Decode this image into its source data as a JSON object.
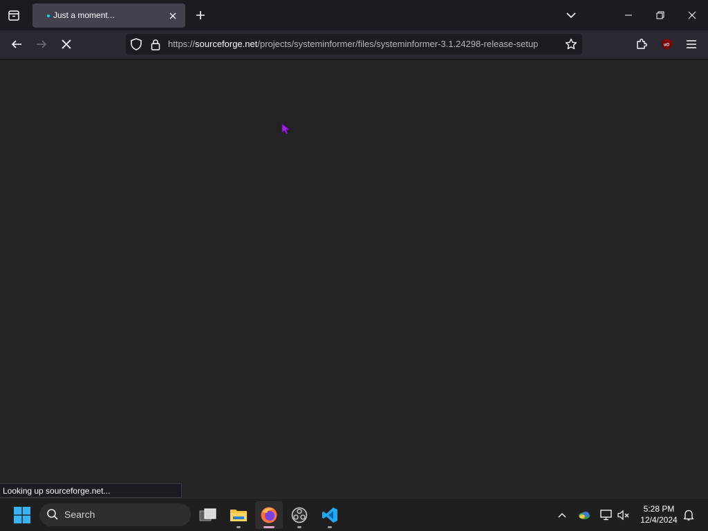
{
  "browser": {
    "tab": {
      "title": "Just a moment..."
    },
    "url": {
      "scheme": "https://",
      "host": "sourceforge.net",
      "path": "/projects/systeminformer/files/systeminformer-3.1.24298-release-setup"
    },
    "status_text": "Looking up sourceforge.net..."
  },
  "icons": {
    "tab_list": "tab-list-icon",
    "new_tab": "plus-icon",
    "overflow": "chevron-down-icon",
    "back": "back-arrow-icon",
    "forward": "forward-arrow-icon",
    "stop": "stop-icon",
    "tracking": "shield-icon",
    "lock": "lock-icon",
    "bookmark": "star-icon",
    "extensions": "puzzle-icon",
    "ublock": "ublock-origin-icon",
    "menu": "hamburger-menu-icon"
  },
  "taskbar": {
    "search_label": "Search",
    "time": "5:28 PM",
    "date": "12/4/2024",
    "apps": [
      "task-view",
      "file-explorer",
      "firefox",
      "obs-studio",
      "vscode"
    ]
  },
  "colors": {
    "accent_tab_dot": "#00ddff",
    "cursor": "#a020f0",
    "ublock": "#800000"
  }
}
